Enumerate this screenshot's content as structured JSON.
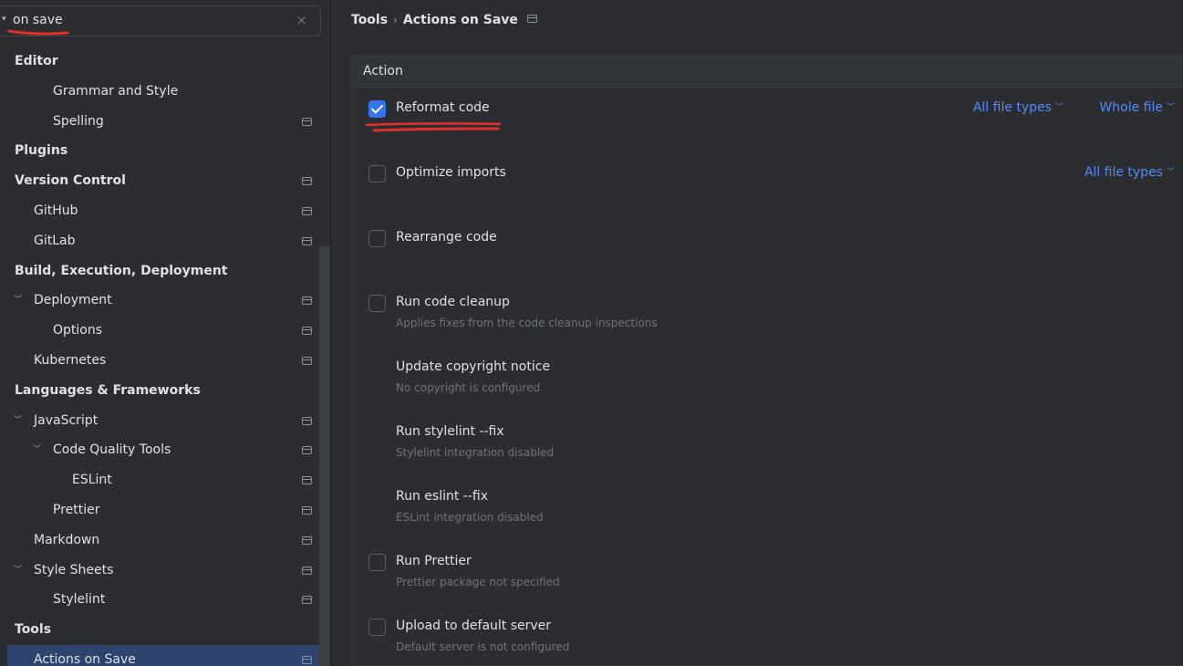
{
  "search": {
    "value": "on save",
    "clear_glyph": "×"
  },
  "sidebar": {
    "items": [
      {
        "label": "Editor",
        "bold": true,
        "indent": 0,
        "chevron": false,
        "icon": false
      },
      {
        "label": "Grammar and Style",
        "bold": false,
        "indent": 58,
        "chevron": false,
        "icon": false
      },
      {
        "label": "Spelling",
        "bold": false,
        "indent": 58,
        "chevron": false,
        "icon": true
      },
      {
        "label": "Plugins",
        "bold": true,
        "indent": 0,
        "chevron": false,
        "icon": false
      },
      {
        "label": "Version Control",
        "bold": true,
        "indent": 0,
        "chevron": false,
        "icon": true
      },
      {
        "label": "GitHub",
        "bold": false,
        "indent": 37,
        "chevron": false,
        "icon": true
      },
      {
        "label": "GitLab",
        "bold": false,
        "indent": 37,
        "chevron": false,
        "icon": true
      },
      {
        "label": "Build, Execution, Deployment",
        "bold": true,
        "indent": 0,
        "chevron": false,
        "icon": false
      },
      {
        "label": "Deployment",
        "bold": false,
        "indent": 37,
        "chevron": true,
        "icon": true
      },
      {
        "label": "Options",
        "bold": false,
        "indent": 58,
        "chevron": false,
        "icon": true
      },
      {
        "label": "Kubernetes",
        "bold": false,
        "indent": 37,
        "chevron": false,
        "icon": true
      },
      {
        "label": "Languages & Frameworks",
        "bold": true,
        "indent": 0,
        "chevron": false,
        "icon": false
      },
      {
        "label": "JavaScript",
        "bold": false,
        "indent": 37,
        "chevron": true,
        "icon": true
      },
      {
        "label": "Code Quality Tools",
        "bold": false,
        "indent": 58,
        "chevron": true,
        "icon": true
      },
      {
        "label": "ESLint",
        "bold": false,
        "indent": 79,
        "chevron": false,
        "icon": true
      },
      {
        "label": "Prettier",
        "bold": false,
        "indent": 58,
        "chevron": false,
        "icon": true
      },
      {
        "label": "Markdown",
        "bold": false,
        "indent": 37,
        "chevron": false,
        "icon": true
      },
      {
        "label": "Style Sheets",
        "bold": false,
        "indent": 37,
        "chevron": true,
        "icon": true
      },
      {
        "label": "Stylelint",
        "bold": false,
        "indent": 58,
        "chevron": false,
        "icon": true
      },
      {
        "label": "Tools",
        "bold": true,
        "indent": 0,
        "chevron": false,
        "icon": false
      },
      {
        "label": "Actions on Save",
        "bold": false,
        "indent": 37,
        "chevron": false,
        "icon": true,
        "selected": true
      }
    ]
  },
  "breadcrumb": {
    "parent": "Tools",
    "separator": "›",
    "current": "Actions on Save"
  },
  "panel": {
    "header": "Action",
    "actions": [
      {
        "label": "Reformat code",
        "desc": "",
        "checkbox": true,
        "checked": true,
        "opt1": "All file types",
        "opt2": "Whole file"
      },
      {
        "label": "Optimize imports",
        "desc": "",
        "checkbox": true,
        "checked": false,
        "opt1": "",
        "opt2": "All file types"
      },
      {
        "label": "Rearrange code",
        "desc": "",
        "checkbox": true,
        "checked": false,
        "opt1": "",
        "opt2": ""
      },
      {
        "label": "Run code cleanup",
        "desc": "Applies fixes from the code cleanup inspections",
        "checkbox": true,
        "checked": false,
        "opt1": "",
        "opt2": ""
      },
      {
        "label": "Update copyright notice",
        "desc": "No copyright is configured",
        "checkbox": false,
        "checked": false,
        "opt1": "",
        "opt2": ""
      },
      {
        "label": "Run stylelint --fix",
        "desc": "Stylelint integration disabled",
        "checkbox": false,
        "checked": false,
        "opt1": "",
        "opt2": ""
      },
      {
        "label": "Run eslint --fix",
        "desc": "ESLint integration disabled",
        "checkbox": false,
        "checked": false,
        "opt1": "",
        "opt2": ""
      },
      {
        "label": "Run Prettier",
        "desc": "Prettier package not specified",
        "checkbox": true,
        "checked": false,
        "opt1": "",
        "opt2": ""
      },
      {
        "label": "Upload to default server",
        "desc": "Default server is not configured",
        "checkbox": true,
        "checked": false,
        "opt1": "",
        "opt2": ""
      }
    ]
  },
  "colors": {
    "accent": "#3574f0",
    "link": "#548af7",
    "annotation": "#e0302a",
    "selection": "#2e436e"
  }
}
